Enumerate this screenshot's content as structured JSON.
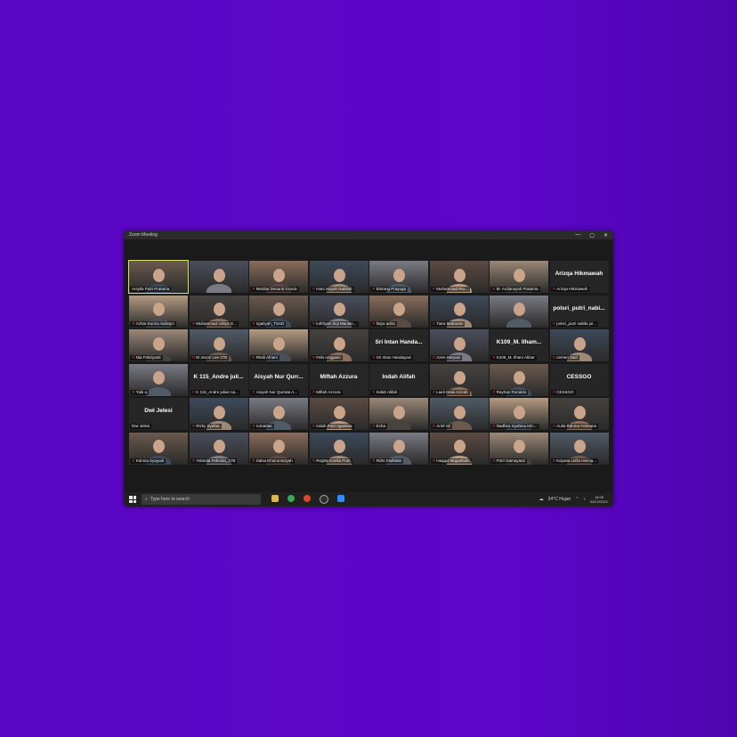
{
  "window": {
    "title": "Zoom Meeting",
    "controls": [
      "—",
      "▢",
      "✕"
    ]
  },
  "colors": {
    "background": "#5b06c6",
    "active_speaker_border": "#d6e36a",
    "muted_icon": "#e23b3b"
  },
  "participants": [
    {
      "label": "Arsyila Putri Pratama",
      "big": "",
      "video": true,
      "active": true,
      "muted": false
    },
    {
      "label": "",
      "big": "",
      "video": true,
      "muted": false
    },
    {
      "label": "Meidiar Desanti Gracia",
      "big": "",
      "video": true,
      "muted": true
    },
    {
      "label": "Hani Aisyah Nabilah",
      "big": "",
      "video": true,
      "muted": true
    },
    {
      "label": "Bintang Prayoga",
      "big": "",
      "video": true,
      "muted": true
    },
    {
      "label": "Muhammad Rio...",
      "big": "",
      "video": true,
      "muted": true
    },
    {
      "label": "M. Ardiansyah Pratama",
      "big": "",
      "video": true,
      "muted": true
    },
    {
      "label": "Arizqa Hikmawah",
      "big": "Arizqa Hikmawah",
      "video": false,
      "muted": true
    },
    {
      "label": "Azhar Kurnia Sulistyo",
      "big": "",
      "video": true,
      "muted": true
    },
    {
      "label": "Muhammad Aditya G...",
      "big": "",
      "video": true,
      "muted": true
    },
    {
      "label": "ngatiyah_TSAD",
      "big": "",
      "video": true,
      "muted": true
    },
    {
      "label": "luthfiyah Siqi Maulan...",
      "big": "",
      "video": true,
      "muted": true
    },
    {
      "label": "fatya adira",
      "big": "",
      "video": true,
      "muted": true
    },
    {
      "label": "Tiara Maharani",
      "big": "",
      "video": true,
      "muted": true
    },
    {
      "label": "",
      "big": "",
      "video": true,
      "muted": false
    },
    {
      "label": "polsri_putri nabila jul...",
      "big": "polsri_putri_nabi...",
      "video": false,
      "muted": true
    },
    {
      "label": "Nia Febriyanti",
      "big": "",
      "video": true,
      "muted": true
    },
    {
      "label": "M Jevon Lee 27B",
      "big": "",
      "video": true,
      "muted": true
    },
    {
      "label": "Rindi Afriani",
      "big": "",
      "video": true,
      "muted": true
    },
    {
      "label": "Febi Anggaini",
      "big": "",
      "video": true,
      "muted": true
    },
    {
      "label": "Sri Intan Handayani",
      "big": "Sri Intan Handa...",
      "video": false,
      "muted": true
    },
    {
      "label": "Azen Haryani",
      "big": "",
      "video": true,
      "muted": true
    },
    {
      "label": "K109_M. Ilham Akbar",
      "big": "K109_M. Ilham...",
      "video": false,
      "muted": true
    },
    {
      "label": "cemen Zaid",
      "big": "",
      "video": true,
      "muted": true
    },
    {
      "label": "Yuki a",
      "big": "",
      "video": true,
      "muted": true
    },
    {
      "label": "K 115_Andre julian sa...",
      "big": "K 115_Andre juli...",
      "video": false,
      "muted": true
    },
    {
      "label": "Aisyah Nur Qurrata A...",
      "big": "Aisyah Nur Qurr...",
      "video": false,
      "muted": true
    },
    {
      "label": "Miftah Azzura",
      "big": "Miftah Azzura",
      "video": false,
      "muted": true
    },
    {
      "label": "Indah Alifah",
      "big": "Indah Alifah",
      "video": false,
      "muted": true
    },
    {
      "label": "Laeli Dewi Azizah",
      "big": "",
      "video": true,
      "muted": true
    },
    {
      "label": "Rayhan Ronaldo",
      "big": "",
      "video": true,
      "muted": true
    },
    {
      "label": "CESSGO",
      "big": "CESSGO",
      "video": false,
      "muted": true
    },
    {
      "label": "Dwi Jelesi",
      "big": "Dwi Jelesi",
      "video": false,
      "muted": false
    },
    {
      "label": "Rizky Syafaa",
      "big": "",
      "video": true,
      "muted": true
    },
    {
      "label": "rumartas",
      "big": "",
      "video": true,
      "muted": true
    },
    {
      "label": "Indah Putri Agustina",
      "big": "",
      "video": true,
      "muted": true
    },
    {
      "label": "Echa",
      "big": "",
      "video": true,
      "muted": true
    },
    {
      "label": "Arief Ali",
      "big": "",
      "video": true,
      "muted": true
    },
    {
      "label": "Nadhira Syahina Kiln...",
      "big": "",
      "video": true,
      "muted": true
    },
    {
      "label": "Aulia Rahma Febriana",
      "big": "",
      "video": true,
      "muted": true
    },
    {
      "label": "Kahnia Syayudi",
      "big": "",
      "video": true,
      "muted": true
    },
    {
      "label": "Yolanda Febriola_17B",
      "big": "",
      "video": true,
      "muted": true
    },
    {
      "label": "Salsa Khoirunnisyah",
      "big": "",
      "video": true,
      "muted": true
    },
    {
      "label": "Regita Amelia Putri",
      "big": "",
      "video": true,
      "muted": true
    },
    {
      "label": "Rizki Fadhilah",
      "big": "",
      "video": true,
      "muted": true
    },
    {
      "label": "Haqqul Mujaahidin",
      "big": "",
      "video": true,
      "muted": true
    },
    {
      "label": "Putri Damayanti",
      "big": "",
      "video": true,
      "muted": true
    },
    {
      "label": "Kayana Usfia Hemia...",
      "big": "",
      "video": true,
      "muted": true
    }
  ],
  "taskbar": {
    "search_placeholder": "Type here to search",
    "weather": "34°C  Hujan",
    "time": "16:08",
    "date": "03/12/2021"
  }
}
